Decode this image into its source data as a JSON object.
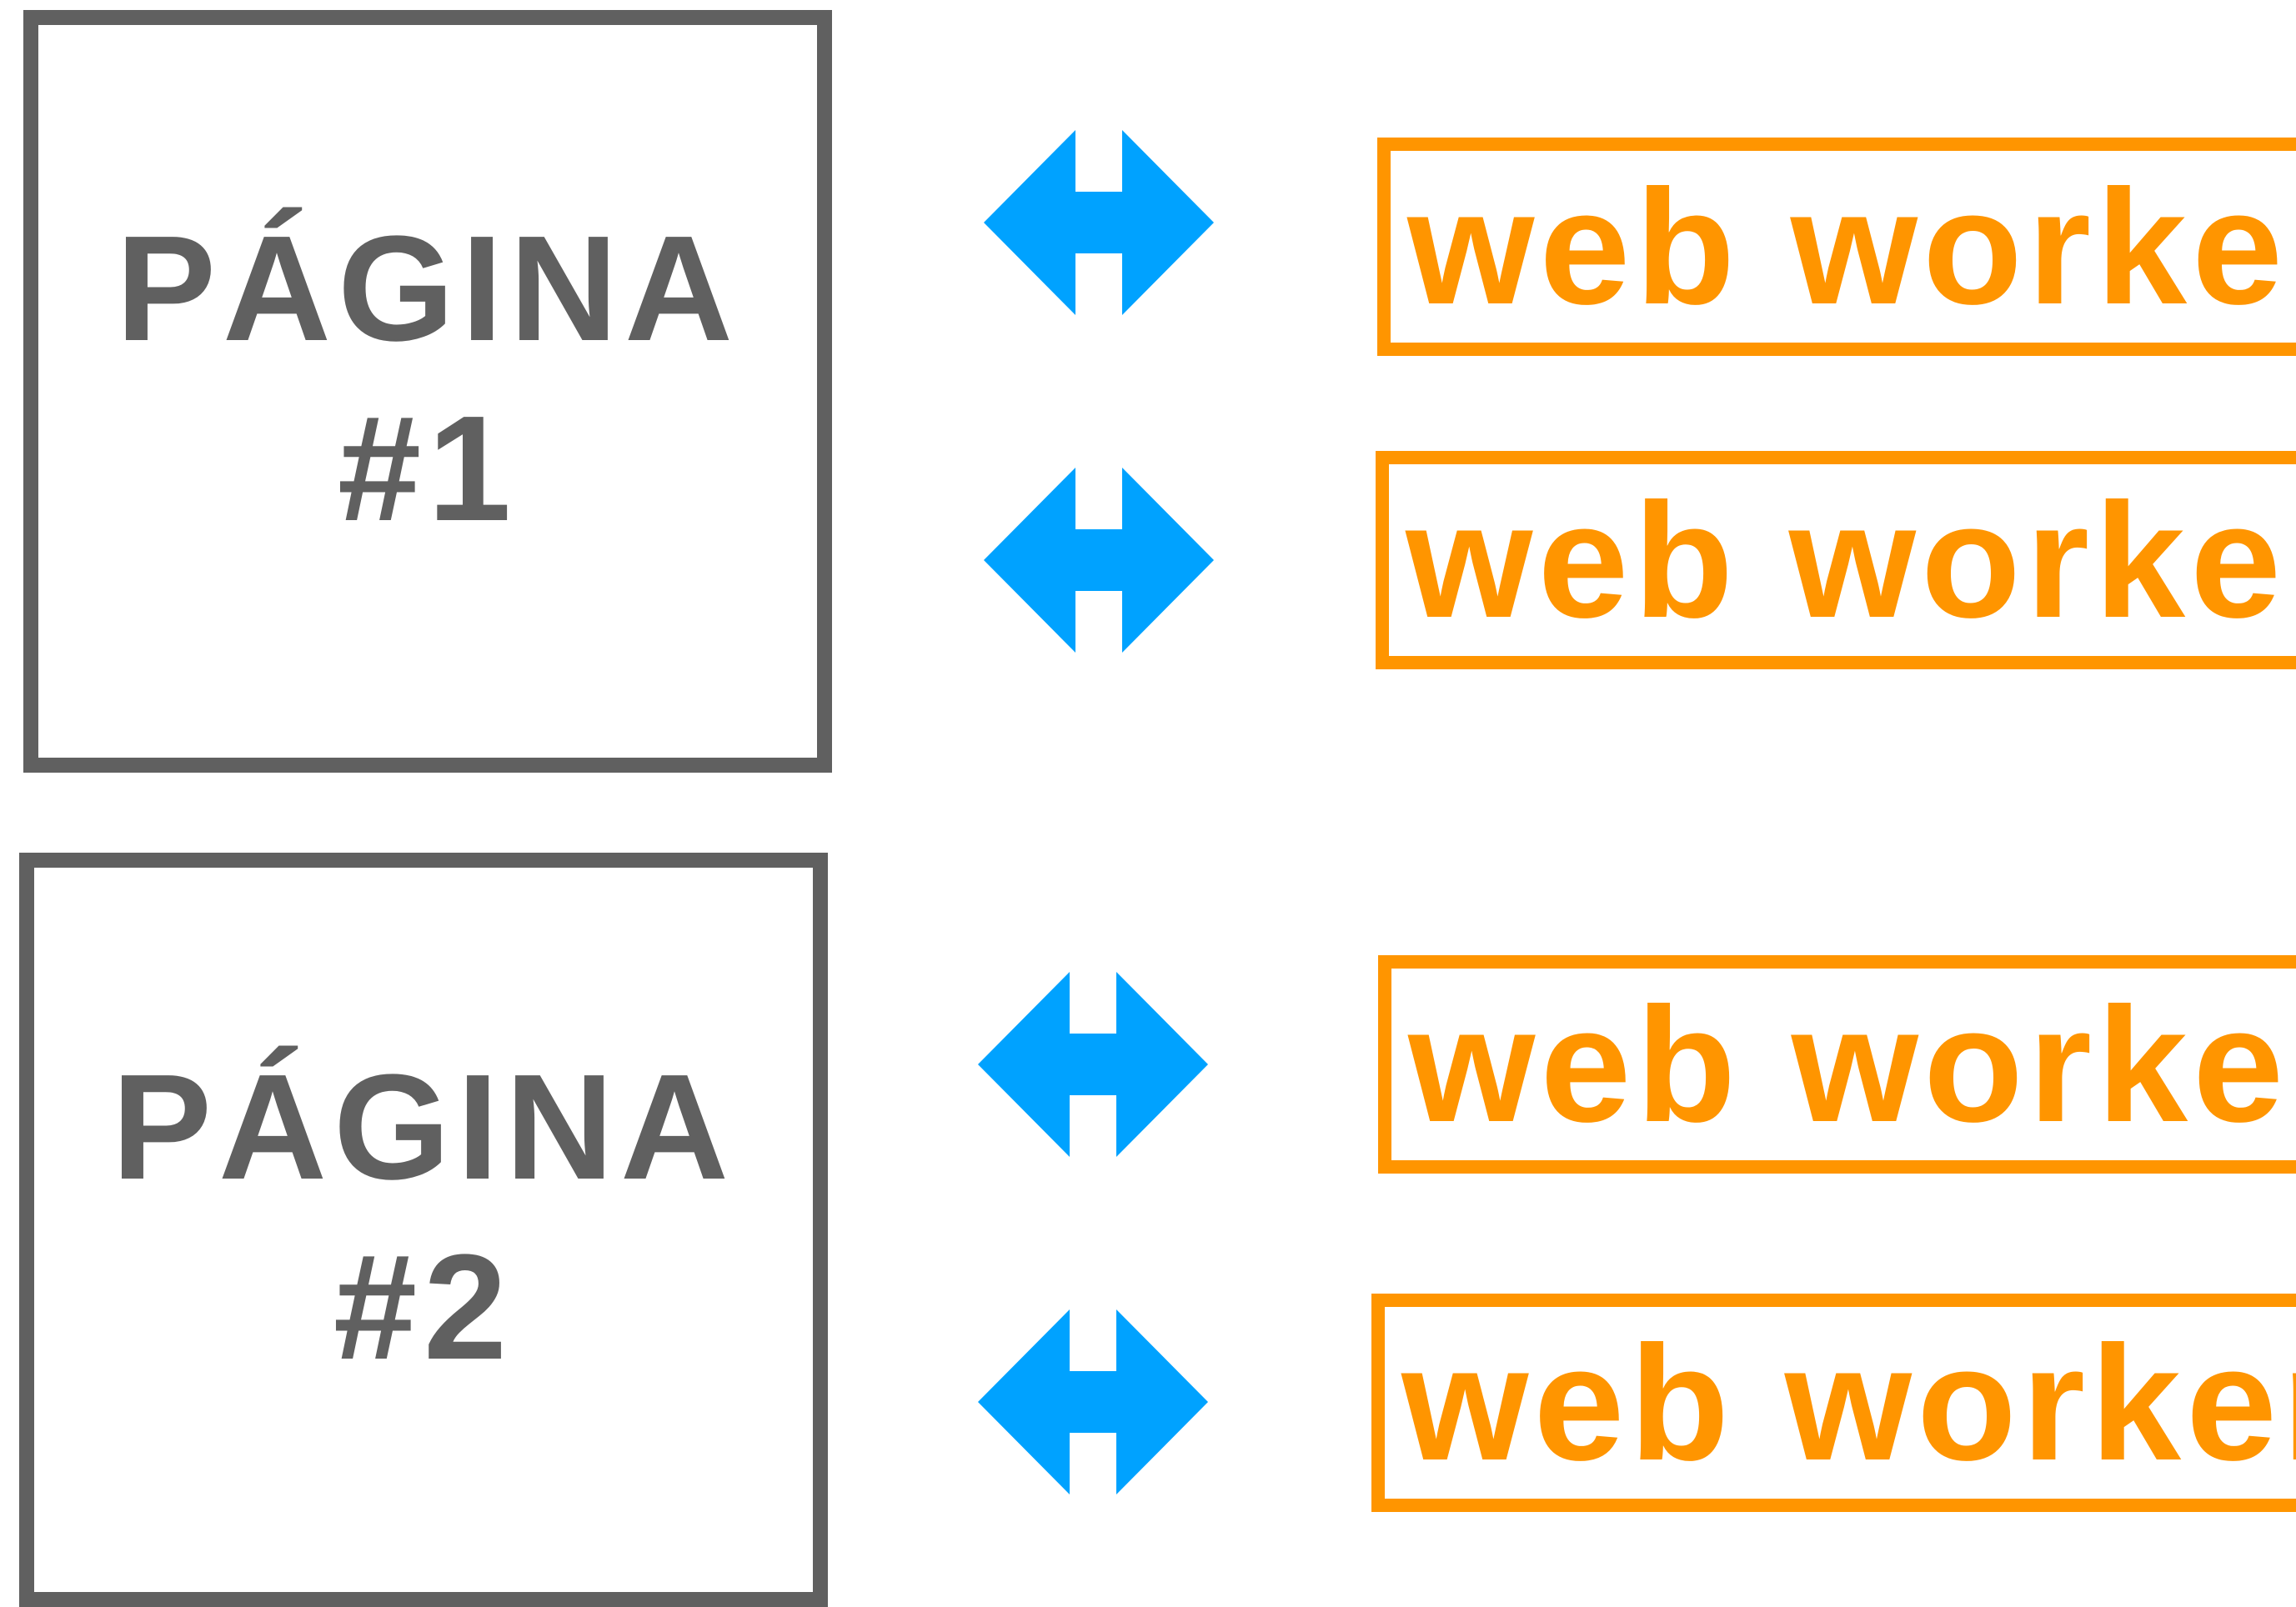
{
  "pages": [
    {
      "title": "PÁGINA",
      "number": "#1",
      "workers": [
        "web worker A",
        "web worker B"
      ]
    },
    {
      "title": "PÁGINA",
      "number": "#2",
      "workers": [
        "web worker A",
        "web worker B"
      ]
    }
  ],
  "colors": {
    "page_border": "#606060",
    "page_text": "#606060",
    "worker": "#FF9500",
    "arrow": "#00A2FF"
  },
  "icons": {
    "connector": "double-headed-arrow-icon"
  }
}
